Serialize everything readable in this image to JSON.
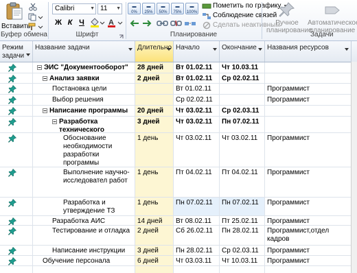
{
  "ribbon": {
    "clipboard": {
      "paste_label": "Вставить",
      "group_label": "Буфер обмена"
    },
    "font": {
      "font_name": "Calibri",
      "font_size": "11",
      "group_label": "Шрифт",
      "bold": "Ж",
      "italic": "К",
      "underline": "Ч"
    },
    "schedule": {
      "percent_buttons": [
        "0%",
        "25%",
        "50%",
        "75%",
        "100%"
      ],
      "mark_on_track": "Пометить по графику",
      "respect_links": "Соблюдение связей",
      "make_inactive": "Сделать неактивным",
      "group_label": "Планирование"
    },
    "tasks": {
      "manual_label_1": "Ручное",
      "manual_label_2": "планирование",
      "auto_label_1": "Автоматическое",
      "auto_label_2": "планирование",
      "group_label": "Задачи"
    }
  },
  "grid": {
    "headers": {
      "mode": "Режим задачи",
      "name": "Название задачи",
      "duration": "Длительно",
      "start": "Начало",
      "finish": "Окончание",
      "resources": "Названия ресурсов"
    },
    "rows": [
      {
        "name": "ЭИС \"Документооборот\"",
        "duration": "28 дней",
        "start": "Вт 01.02.11",
        "finish": "Чт 10.03.11",
        "resources": ""
      },
      {
        "name": "Анализ заявки",
        "duration": "2 дней",
        "start": "Вт 01.02.11",
        "finish": "Ср 02.02.11",
        "resources": ""
      },
      {
        "name": "Постановка цели",
        "duration": "",
        "start": "Вт 01.02.11",
        "finish": "",
        "resources": "Программист"
      },
      {
        "name": "Выбор решения",
        "duration": "",
        "start": "Ср 02.02.11",
        "finish": "",
        "resources": "Программист"
      },
      {
        "name": "Написание программы",
        "duration": "20 дней",
        "start": "Чт 03.02.11",
        "finish": "Ср 02.03.11",
        "resources": ""
      },
      {
        "name": "Разработка технического задания",
        "duration": "3 дней",
        "start": "Чт 03.02.11",
        "finish": "Пн 07.02.11",
        "resources": ""
      },
      {
        "name": "Обоснование необходимости разработки программы",
        "duration": "1 день",
        "start": "Чт 03.02.11",
        "finish": "Чт 03.02.11",
        "resources": "Программист"
      },
      {
        "name": "Выполнение научно-исследовател работ",
        "duration": "1 день",
        "start": "Пт 04.02.11",
        "finish": "Пт 04.02.11",
        "resources": "Программист"
      },
      {
        "name": "Разработка и утверждение ТЗ",
        "duration": "1 день",
        "start": "Пн 07.02.11",
        "finish": "Пн 07.02.11",
        "resources": "Программист"
      },
      {
        "name": "Разработка АИС",
        "duration": "14 дней",
        "start": "Вт 08.02.11",
        "finish": "Пт 25.02.11",
        "resources": "Программист"
      },
      {
        "name": "Тестирование и отладка",
        "duration": "2 дней",
        "start": "Сб 26.02.11",
        "finish": "Пн 28.02.11",
        "resources": "Программист,отдел кадров"
      },
      {
        "name": "Написание инструкции",
        "duration": "3 дней",
        "start": "Пн 28.02.11",
        "finish": "Ср 02.03.11",
        "resources": "Программист"
      },
      {
        "name": "Обучение персонала",
        "duration": "6 дней",
        "start": "Чт 03.03.11",
        "finish": "Чт 10.03.11",
        "resources": "Программист"
      },
      {
        "name": "",
        "duration": "",
        "start": "",
        "finish": "",
        "resources": ""
      }
    ]
  },
  "colors": {
    "accent_header": "#fbe27a",
    "pin": "#1f9d8f",
    "selected_row": "#e5f0fb"
  }
}
